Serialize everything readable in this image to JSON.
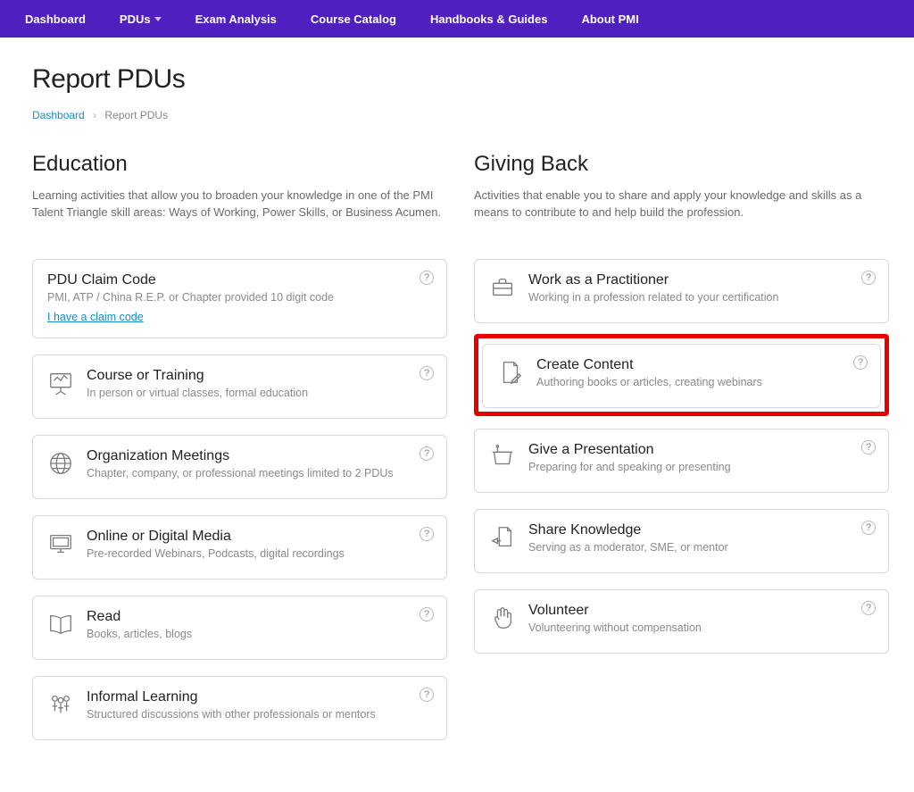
{
  "nav": {
    "items": [
      "Dashboard",
      "PDUs",
      "Exam Analysis",
      "Course Catalog",
      "Handbooks & Guides",
      "About PMI"
    ]
  },
  "page": {
    "title": "Report PDUs"
  },
  "breadcrumb": {
    "home": "Dashboard",
    "current": "Report PDUs"
  },
  "columns": {
    "education": {
      "heading": "Education",
      "desc": "Learning activities that allow you to broaden your knowledge in one of the PMI Talent Triangle skill areas: Ways of Working, Power Skills, or Business Acumen."
    },
    "giving": {
      "heading": "Giving Back",
      "desc": "Activities that enable you to share and apply your knowledge and skills as a means to contribute to and help build the profession."
    }
  },
  "education_cards": {
    "pdu_code": {
      "title": "PDU Claim Code",
      "sub": "PMI, ATP / China R.E.P. or Chapter provided 10 digit code",
      "link": "I have a claim code"
    },
    "course": {
      "title": "Course or Training",
      "sub": "In person or virtual classes, formal education"
    },
    "org": {
      "title": "Organization Meetings",
      "sub": "Chapter, company, or professional meetings limited to 2 PDUs"
    },
    "digital": {
      "title": "Online or Digital Media",
      "sub": "Pre-recorded Webinars, Podcasts, digital recordings"
    },
    "read": {
      "title": "Read",
      "sub": "Books, articles, blogs"
    },
    "informal": {
      "title": "Informal Learning",
      "sub": "Structured discussions with other professionals or mentors"
    }
  },
  "giving_cards": {
    "practitioner": {
      "title": "Work as a Practitioner",
      "sub": "Working in a profession related to your certification"
    },
    "create": {
      "title": "Create Content",
      "sub": "Authoring books or articles, creating webinars"
    },
    "present": {
      "title": "Give a Presentation",
      "sub": "Preparing for and speaking or presenting"
    },
    "share": {
      "title": "Share Knowledge",
      "sub": "Serving as a moderator, SME, or mentor"
    },
    "volunteer": {
      "title": "Volunteer",
      "sub": "Volunteering without compensation"
    }
  },
  "help_glyph": "?"
}
